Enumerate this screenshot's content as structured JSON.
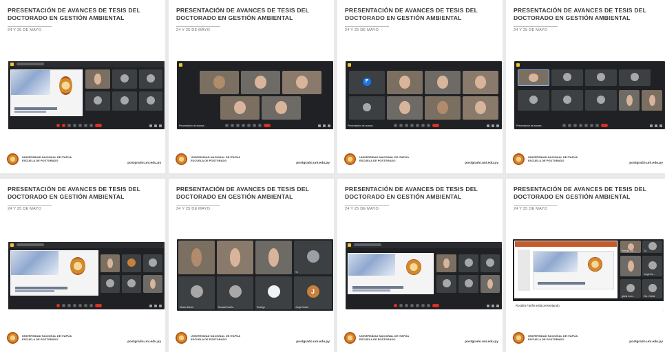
{
  "slide": {
    "title": "PRESENTACIÓN DE AVANCES DE TESIS DEL DOCTORADO EN GESTIÓN AMBIENTAL",
    "subtitle": "24 Y 25 DE MAYO",
    "university": "UNIVERSIDAD NACIONAL DE ITAPÚA",
    "school": "ESCUELA DE POSTGRADO",
    "url": "postgrado.uni.edu.py"
  },
  "colors": {
    "accent": "#f4c430",
    "end_call": "#d93025",
    "meet_bg": "#202124",
    "user_avatar": "#1a73e8"
  },
  "cards": [
    {
      "tiles": [
        "",
        "",
        "",
        "",
        "",
        ""
      ],
      "caption": ""
    },
    {
      "tiles": [
        "",
        "",
        "",
        "",
        ""
      ],
      "caption": "Presentación de avance..."
    },
    {
      "tiles": [
        "F",
        "",
        "",
        "",
        "",
        "",
        "",
        ""
      ],
      "caption": "Presentación de avance..."
    },
    {
      "tiles": [
        "",
        "",
        "",
        "",
        "",
        "",
        "",
        "",
        ""
      ],
      "caption": "Presentación de avance..."
    },
    {
      "tiles": [
        "",
        "",
        "",
        "",
        "",
        ""
      ],
      "caption": ""
    },
    {
      "tiles": [
        "Néstor David",
        "Rosalía Fariña",
        "Rodrigo",
        "Jorge Daniel",
        "Tú"
      ],
      "caption": ""
    },
    {
      "tiles": [
        "",
        "",
        "",
        "",
        "",
        ""
      ],
      "caption": ""
    },
    {
      "side_names": [
        "Presilla Val...",
        "Tú",
        "Jorge Do...",
        "glória Lom...",
        "Chr. Orella"
      ],
      "banner": "Rosalía Fariña está presentando"
    }
  ],
  "card6": {
    "names": [
      "Néstor David",
      "Rosalía Fariña",
      "Rodrigo",
      "Jorge Daniel",
      "Tú"
    ],
    "initial": "J"
  },
  "card3": {
    "initial": "F"
  }
}
